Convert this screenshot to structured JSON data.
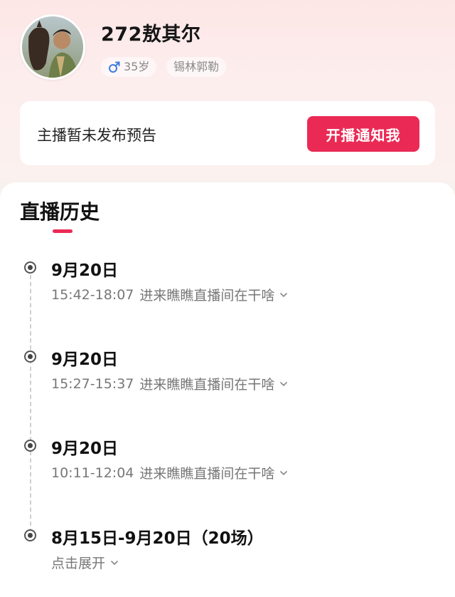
{
  "profile": {
    "name": "272敖其尔",
    "gender_symbol": "♂",
    "age": "35岁",
    "region": "锡林郭勒",
    "avatar_icon": "avatar-photo"
  },
  "notice": {
    "text": "主播暂未发布预告",
    "button_label": "开播通知我"
  },
  "history": {
    "title": "直播历史",
    "items": [
      {
        "date": "9月20日",
        "time": "15:42-18:07",
        "desc": "进来瞧瞧直播间在干啥"
      },
      {
        "date": "9月20日",
        "time": "15:27-15:37",
        "desc": "进来瞧瞧直播间在干啥"
      },
      {
        "date": "9月20日",
        "time": "10:11-12:04",
        "desc": "进来瞧瞧直播间在干啥"
      }
    ],
    "summary": {
      "date_range": "8月15日-9月20日（20场）",
      "expand_label": "点击展开"
    }
  },
  "colors": {
    "accent": "#ea2a55",
    "male": "#3b7de0"
  }
}
